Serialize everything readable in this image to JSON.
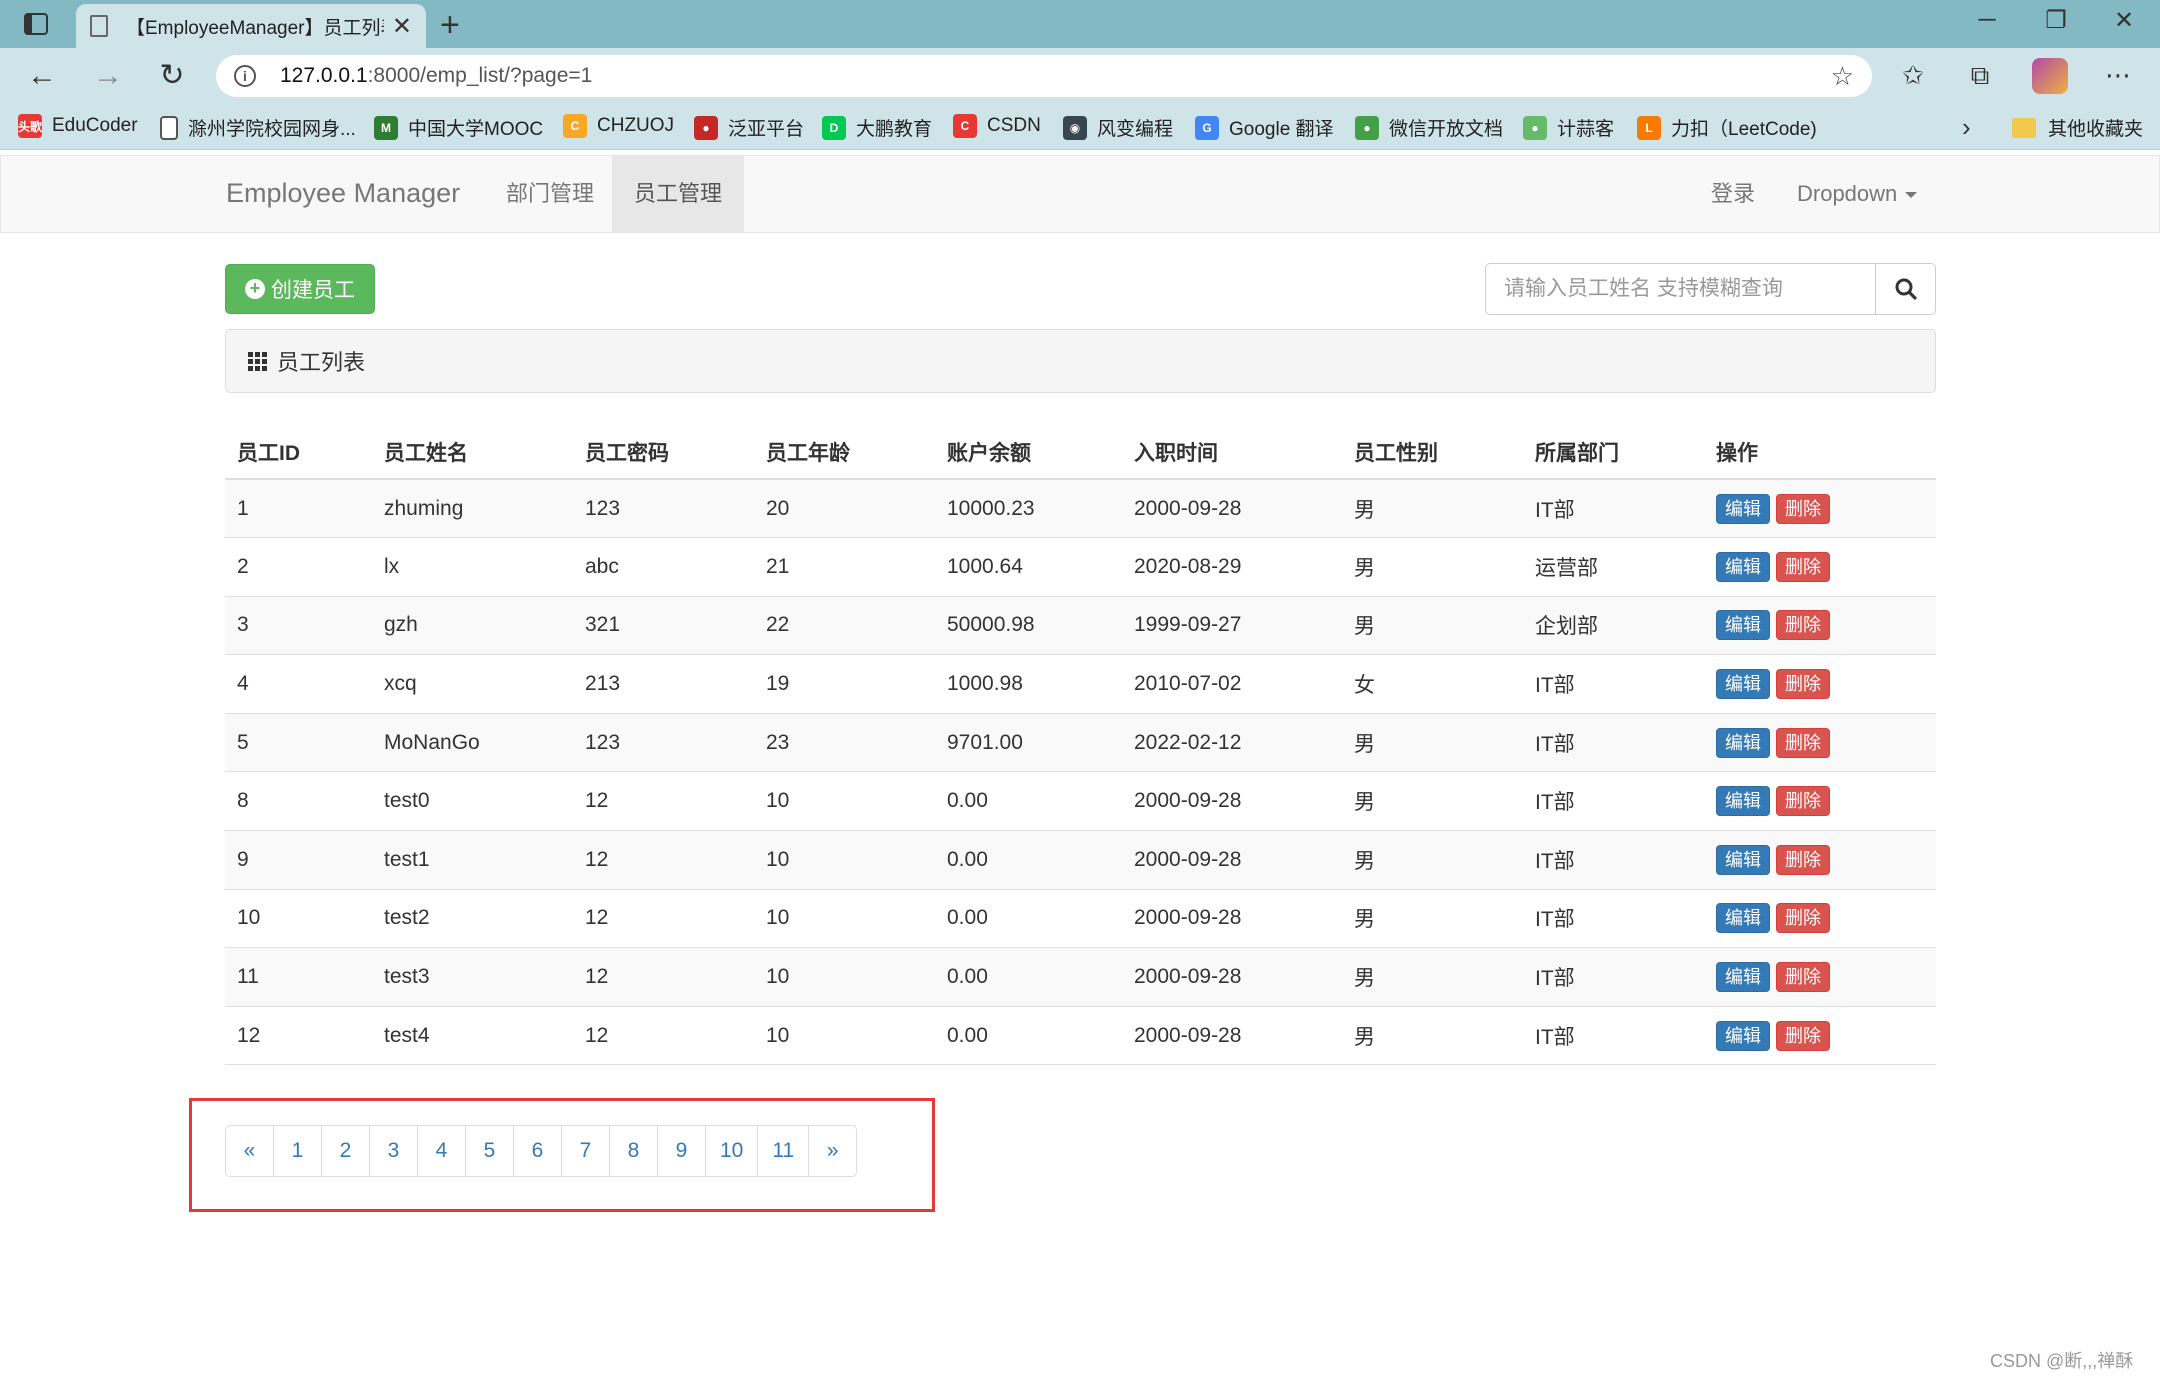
{
  "browser": {
    "tab_title": "【EmployeeManager】员工列表",
    "url_host": "127.0.0.1",
    "url_rest": ":8000/emp_list/?page=1",
    "bookmarks": [
      {
        "label": "EduCoder",
        "icon": "educoder-icon",
        "color": "#e53935",
        "glyph": "头歌"
      },
      {
        "label": "滁州学院校园网身...",
        "icon": "page-icon",
        "color": "#ffffff",
        "glyph": ""
      },
      {
        "label": "中国大学MOOC",
        "icon": "mooc-icon",
        "color": "#2e7d32",
        "glyph": "M"
      },
      {
        "label": "CHZUOJ",
        "icon": "chzuoj-icon",
        "color": "#f9a825",
        "glyph": "C"
      },
      {
        "label": "泛亚平台",
        "icon": "fanya-icon",
        "color": "#c62828",
        "glyph": "●"
      },
      {
        "label": "大鹏教育",
        "icon": "dapeng-icon",
        "color": "#00c853",
        "glyph": "D"
      },
      {
        "label": "CSDN",
        "icon": "csdn-icon",
        "color": "#e53935",
        "glyph": "C"
      },
      {
        "label": "风变编程",
        "icon": "fengbian-icon",
        "color": "#37474f",
        "glyph": "◉"
      },
      {
        "label": "Google 翻译",
        "icon": "google-translate-icon",
        "color": "#4285f4",
        "glyph": "G"
      },
      {
        "label": "微信开放文档",
        "icon": "wechat-icon",
        "color": "#43a047",
        "glyph": "●"
      },
      {
        "label": "计蒜客",
        "icon": "jisuanke-icon",
        "color": "#66bb6a",
        "glyph": "●"
      },
      {
        "label": "力扣（LeetCode)",
        "icon": "leetcode-icon",
        "color": "#f57c00",
        "glyph": "L"
      }
    ],
    "other_bookmarks": "其他收藏夹"
  },
  "navbar": {
    "brand": "Employee Manager",
    "links": [
      "部门管理",
      "员工管理"
    ],
    "active": "员工管理",
    "login": "登录",
    "dropdown": "Dropdown"
  },
  "toolbar": {
    "create_label": "创建员工",
    "search_placeholder": "请输入员工姓名 支持模糊查询"
  },
  "panel": {
    "title": "员工列表"
  },
  "table": {
    "headers": [
      "员工ID",
      "员工姓名",
      "员工密码",
      "员工年龄",
      "账户余额",
      "入职时间",
      "员工性别",
      "所属部门",
      "操作"
    ],
    "edit_label": "编辑",
    "delete_label": "删除",
    "rows": [
      [
        "1",
        "zhuming",
        "123",
        "20",
        "10000.23",
        "2000-09-28",
        "男",
        "IT部"
      ],
      [
        "2",
        "lx",
        "abc",
        "21",
        "1000.64",
        "2020-08-29",
        "男",
        "运营部"
      ],
      [
        "3",
        "gzh",
        "321",
        "22",
        "50000.98",
        "1999-09-27",
        "男",
        "企划部"
      ],
      [
        "4",
        "xcq",
        "213",
        "19",
        "1000.98",
        "2010-07-02",
        "女",
        "IT部"
      ],
      [
        "5",
        "MoNanGo",
        "123",
        "23",
        "9701.00",
        "2022-02-12",
        "男",
        "IT部"
      ],
      [
        "8",
        "test0",
        "12",
        "10",
        "0.00",
        "2000-09-28",
        "男",
        "IT部"
      ],
      [
        "9",
        "test1",
        "12",
        "10",
        "0.00",
        "2000-09-28",
        "男",
        "IT部"
      ],
      [
        "10",
        "test2",
        "12",
        "10",
        "0.00",
        "2000-09-28",
        "男",
        "IT部"
      ],
      [
        "11",
        "test3",
        "12",
        "10",
        "0.00",
        "2000-09-28",
        "男",
        "IT部"
      ],
      [
        "12",
        "test4",
        "12",
        "10",
        "0.00",
        "2000-09-28",
        "男",
        "IT部"
      ]
    ]
  },
  "pagination": [
    "«",
    "1",
    "2",
    "3",
    "4",
    "5",
    "6",
    "7",
    "8",
    "9",
    "10",
    "11",
    "»"
  ],
  "watermark": "CSDN @断,,,禅酥",
  "colors": {
    "tabbar": "#83b9c3",
    "toolbar": "#cfe4e8",
    "success": "#5cb85c",
    "primary": "#337ab7",
    "danger": "#d9534f",
    "highlight": "#e53935"
  }
}
